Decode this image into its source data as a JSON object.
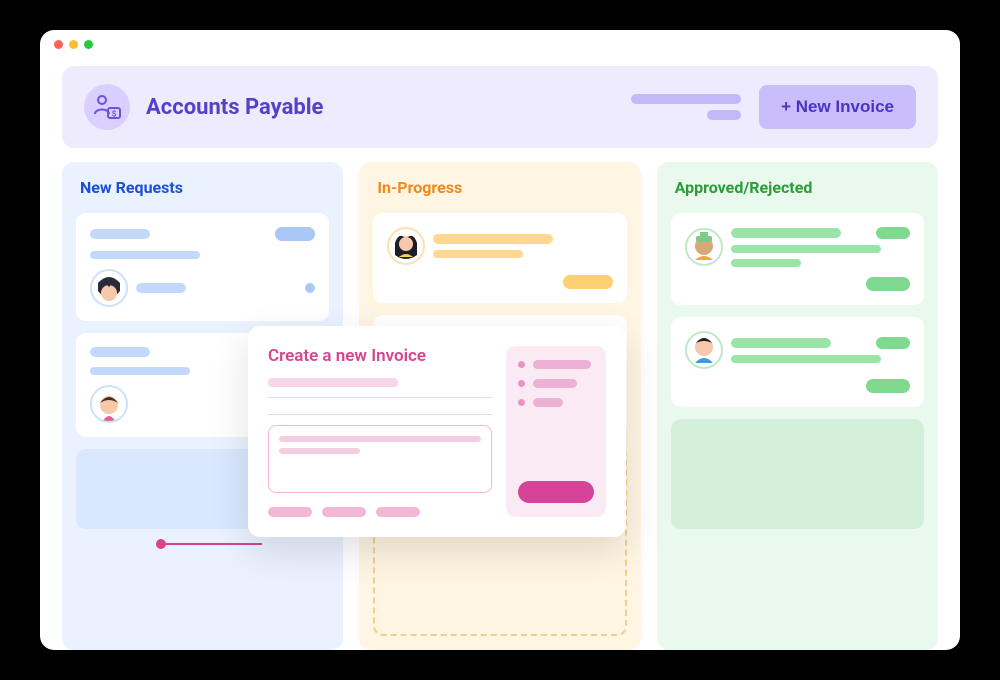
{
  "header": {
    "title": "Accounts Payable",
    "new_invoice_label": "+ New Invoice"
  },
  "columns": {
    "new_requests": {
      "title": "New Requests"
    },
    "in_progress": {
      "title": "In-Progress"
    },
    "approved": {
      "title": "Approved/Rejected"
    }
  },
  "modal": {
    "title": "Create a new Invoice"
  }
}
